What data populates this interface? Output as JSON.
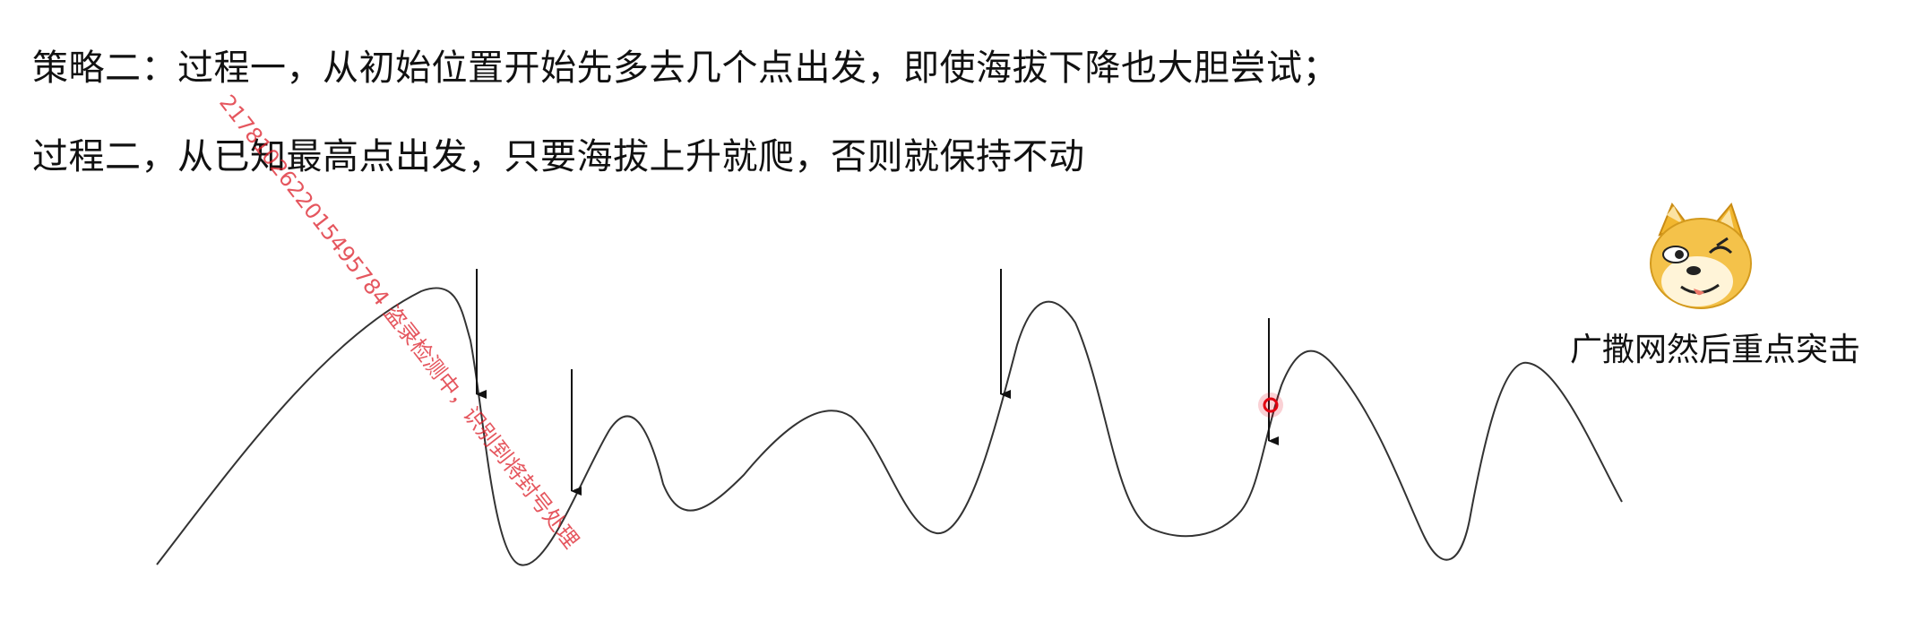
{
  "slide": {
    "line1": "策略二：过程一，从初始位置开始先多去几个点出发，即使海拔下降也大胆尝试；",
    "line2": "过程二，从已知最高点出发，只要海拔上升就爬，否则就保持不动",
    "caption": "广撒网然后重点突击",
    "watermark": "2178102622015495784 盗录检测中，识别到将封号处理"
  },
  "icons": {
    "sticker": "doge-face-sticker",
    "cursor": "red-cursor-dot"
  },
  "colors": {
    "text": "#111111",
    "curve": "#333333",
    "watermark": "#dc1e28",
    "cursor": "#e00010"
  }
}
